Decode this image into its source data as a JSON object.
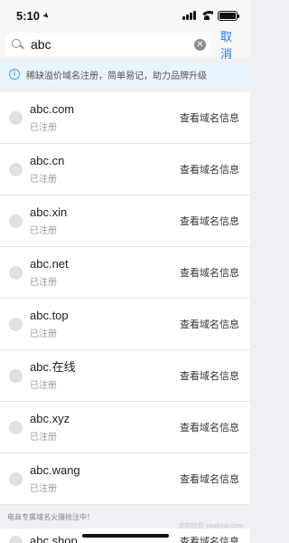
{
  "status_bar": {
    "time": "5:10"
  },
  "search": {
    "value": "abc",
    "cancel_label": "取消"
  },
  "notice": {
    "text": "稀缺溢价域名注册，简单易记，助力品牌升级"
  },
  "domains": [
    {
      "name": "abc.com",
      "status": "已注册",
      "action": "查看域名信息"
    },
    {
      "name": "abc.cn",
      "status": "已注册",
      "action": "查看域名信息"
    },
    {
      "name": "abc.xin",
      "status": "已注册",
      "action": "查看域名信息"
    },
    {
      "name": "abc.net",
      "status": "已注册",
      "action": "查看域名信息"
    },
    {
      "name": "abc.top",
      "status": "已注册",
      "action": "查看域名信息"
    },
    {
      "name": "abc.在线",
      "status": "已注册",
      "action": "查看域名信息"
    },
    {
      "name": "abc.xyz",
      "status": "已注册",
      "action": "查看域名信息"
    },
    {
      "name": "abc.wang",
      "status": "已注册",
      "action": "查看域名信息"
    }
  ],
  "section": {
    "label": "电商专属域名火爆抢注中！"
  },
  "partial": {
    "name": "abc.shop",
    "action": "查看域名信息"
  },
  "watermark": "你的社区 youjiyun.com"
}
